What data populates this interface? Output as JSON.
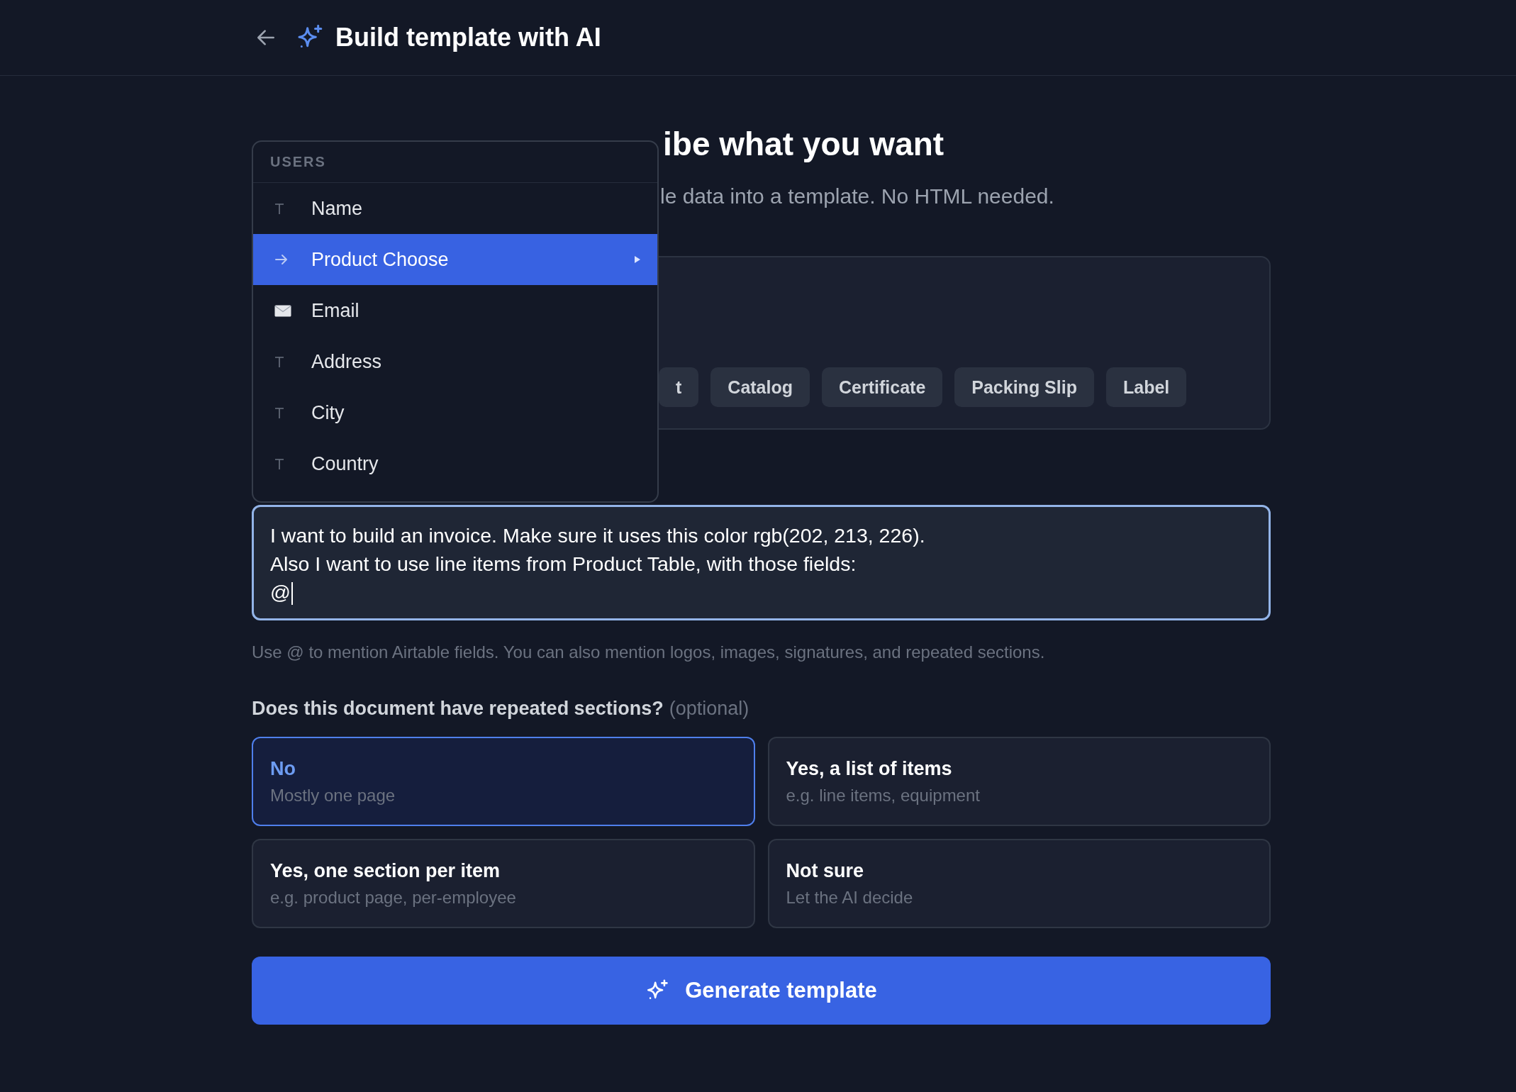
{
  "header": {
    "title": "Build template with AI"
  },
  "heading": "ibe what you want",
  "subtitle": "le data into a template. No HTML needed.",
  "template_types": [
    "t",
    "Catalog",
    "Certificate",
    "Packing Slip",
    "Label"
  ],
  "mention_menu": {
    "group": "USERS",
    "items": [
      {
        "label": "Name",
        "kind": "text",
        "selected": false,
        "has_submenu": false
      },
      {
        "label": "Product Choose",
        "kind": "link",
        "selected": true,
        "has_submenu": true
      },
      {
        "label": "Email",
        "kind": "email",
        "selected": false,
        "has_submenu": false
      },
      {
        "label": "Address",
        "kind": "text",
        "selected": false,
        "has_submenu": false
      },
      {
        "label": "City",
        "kind": "text",
        "selected": false,
        "has_submenu": false
      },
      {
        "label": "Country",
        "kind": "text",
        "selected": false,
        "has_submenu": false
      }
    ]
  },
  "prompt": {
    "lines": [
      "I want to build an invoice. Make sure it uses this color rgb(202, 213, 226).",
      "Also I want to use line items from Product Table, with those fields:",
      "@"
    ]
  },
  "hint": "Use @ to mention Airtable fields. You can also mention logos, images, signatures, and repeated sections.",
  "repeat_question": {
    "label": "Does this document have repeated sections?",
    "note": "(optional)",
    "options": [
      {
        "title": "No",
        "subtitle": "Mostly one page",
        "selected": true
      },
      {
        "title": "Yes, a list of items",
        "subtitle": "e.g. line items, equipment",
        "selected": false
      },
      {
        "title": "Yes, one section per item",
        "subtitle": "e.g. product page, per-employee",
        "selected": false
      },
      {
        "title": "Not sure",
        "subtitle": "Let the AI decide",
        "selected": false
      }
    ]
  },
  "generate_button": {
    "label": "Generate template"
  }
}
